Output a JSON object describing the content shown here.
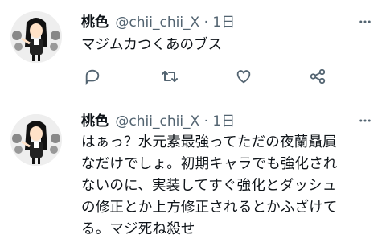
{
  "tweets": [
    {
      "name": "桃色",
      "handle": "@chii_chii_X",
      "separator": "·",
      "time": "1日",
      "text": "マジムカつくあのブス",
      "icons": [
        "avatar-girl",
        "more-icon",
        "reply-icon",
        "retweet-icon",
        "like-icon",
        "share-icon"
      ]
    },
    {
      "name": "桃色",
      "handle": "@chii_chii_X",
      "separator": "·",
      "time": "1日",
      "text": "はぁっ？水元素最強ってただの夜蘭贔屓\nなだけでしょ。初期キャラでも強化され\nないのに、実装してすぐ強化とダッシュ\nの修正とか上方修正されるとかふざけて\nる。マジ死ね殺せ",
      "icons": [
        "avatar-girl",
        "more-icon"
      ]
    }
  ],
  "colors": {
    "text": "#0f1419",
    "secondary": "#536471",
    "divider": "#e6ecf0",
    "icon": "#536471"
  }
}
